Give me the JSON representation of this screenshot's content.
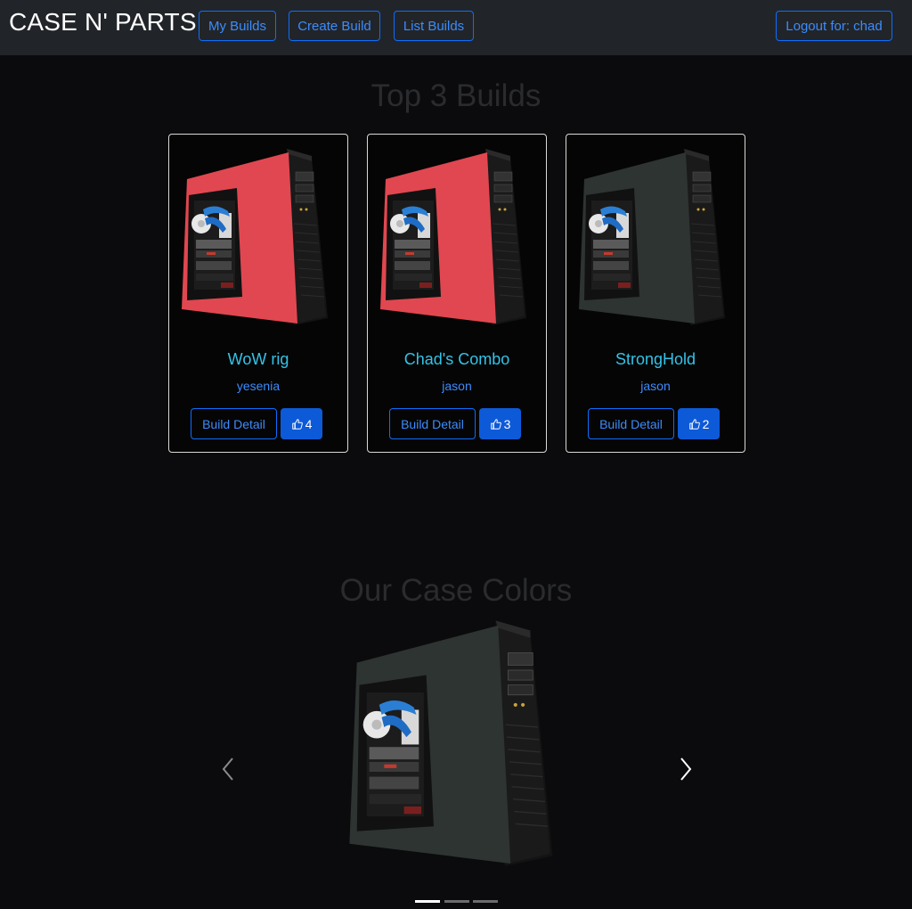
{
  "navbar": {
    "brand": "CASE N' PARTS",
    "links": [
      "My Builds",
      "Create Build",
      "List Builds"
    ],
    "logout": "Logout for: chad"
  },
  "top_builds": {
    "title": "Top 3 Builds",
    "cards": [
      {
        "name": "WoW rig",
        "author": "yesenia",
        "detail_label": "Build Detail",
        "likes": "4",
        "case_color": "#e14750"
      },
      {
        "name": "Chad's Combo",
        "author": "jason",
        "detail_label": "Build Detail",
        "likes": "3",
        "case_color": "#e14750"
      },
      {
        "name": "StrongHold",
        "author": "jason",
        "detail_label": "Build Detail",
        "likes": "2",
        "case_color": "#2e3431"
      }
    ]
  },
  "case_colors": {
    "title": "Our Case Colors",
    "active_slide": 1,
    "slide_count": 3,
    "current_color": "#2e3431"
  },
  "icons": {
    "like": "thumbs-up-icon",
    "prev": "chevron-left-icon",
    "next": "chevron-right-icon"
  }
}
